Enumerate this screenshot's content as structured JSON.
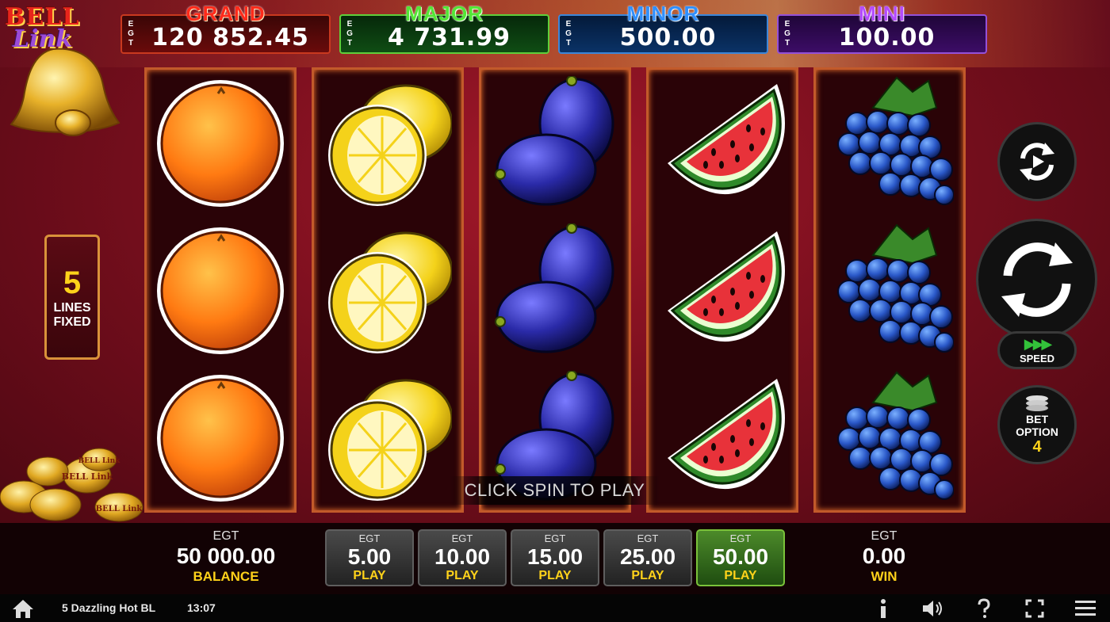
{
  "logo": {
    "line1": "BELL",
    "line2": "Link"
  },
  "jackpots": [
    {
      "name": "GRAND",
      "currency": "EGT",
      "value": "120 852.45"
    },
    {
      "name": "MAJOR",
      "currency": "EGT",
      "value": "4 731.99"
    },
    {
      "name": "MINOR",
      "currency": "EGT",
      "value": "500.00"
    },
    {
      "name": "MINI",
      "currency": "EGT",
      "value": "100.00"
    }
  ],
  "reels": [
    [
      "orange",
      "orange",
      "orange"
    ],
    [
      "lemon",
      "lemon",
      "lemon"
    ],
    [
      "plum",
      "plum",
      "plum"
    ],
    [
      "watermelon",
      "watermelon",
      "watermelon"
    ],
    [
      "grapes",
      "grapes",
      "grapes"
    ]
  ],
  "message": "CLICK SPIN TO PLAY",
  "lines": {
    "count": "5",
    "label1": "LINES",
    "label2": "FIXED"
  },
  "coins_text": [
    "BELL Link",
    "BELL Link",
    "BELL Link"
  ],
  "controls": {
    "speed_label": "SPEED",
    "bet_option_label1": "BET",
    "bet_option_label2": "OPTION",
    "bet_option_value": "4"
  },
  "balance": {
    "currency": "EGT",
    "amount": "50 000.00",
    "label": "BALANCE"
  },
  "win": {
    "currency": "EGT",
    "amount": "0.00",
    "label": "WIN"
  },
  "bets": [
    {
      "currency": "EGT",
      "value": "5.00",
      "label": "PLAY",
      "active": false
    },
    {
      "currency": "EGT",
      "value": "10.00",
      "label": "PLAY",
      "active": false
    },
    {
      "currency": "EGT",
      "value": "15.00",
      "label": "PLAY",
      "active": false
    },
    {
      "currency": "EGT",
      "value": "25.00",
      "label": "PLAY",
      "active": false
    },
    {
      "currency": "EGT",
      "value": "50.00",
      "label": "PLAY",
      "active": true
    }
  ],
  "status_bar": {
    "game_name": "5 Dazzling Hot BL",
    "time": "13:07",
    "icons": [
      "home-icon",
      "info-icon",
      "sound-icon",
      "help-icon",
      "fullscreen-icon",
      "menu-icon"
    ]
  },
  "colors": {
    "grand": "#ff2a1a",
    "major": "#52e635",
    "minor": "#2f8fff",
    "mini": "#b44bff",
    "accent_yellow": "#ffd21a",
    "active_bet": "#4c8a2a"
  }
}
